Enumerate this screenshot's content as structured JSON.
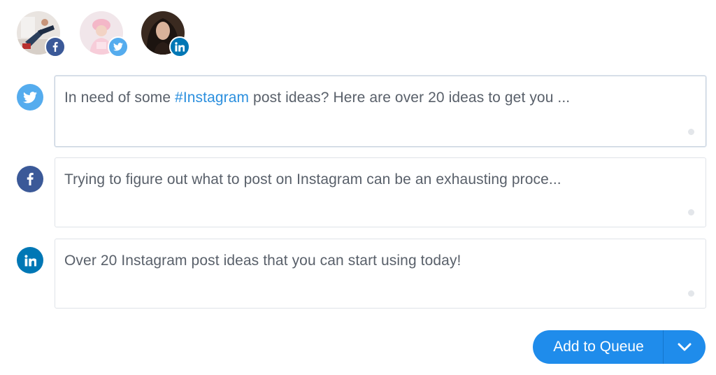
{
  "accounts": [
    {
      "network": "facebook",
      "avatar": "avatar-photo-man",
      "badge_icon": "facebook-icon",
      "badge_color": "#3b5998"
    },
    {
      "network": "twitter",
      "avatar": "avatar-photo-woman-pink",
      "badge_icon": "twitter-icon",
      "badge_color": "#55acee"
    },
    {
      "network": "linkedin",
      "avatar": "avatar-photo-woman-dark",
      "badge_icon": "linkedin-icon",
      "badge_color": "#0077b5"
    }
  ],
  "composers": {
    "twitter": {
      "icon": "twitter-icon",
      "color": "#55acee",
      "text_before": "In need of some ",
      "hashtag": "#Instagram",
      "text_after": " post ideas? Here are over 20 ideas to get you ..."
    },
    "facebook": {
      "icon": "facebook-icon",
      "color": "#3b5998",
      "text": "Trying to figure out what to post on Instagram can be an exhausting proce..."
    },
    "linkedin": {
      "icon": "linkedin-icon",
      "color": "#0077b5",
      "text": "Over 20 Instagram post ideas that you can start using today!"
    }
  },
  "actions": {
    "add_to_queue_label": "Add to Queue",
    "dropdown_icon": "chevron-down-icon",
    "button_color": "#1f8ceb"
  }
}
